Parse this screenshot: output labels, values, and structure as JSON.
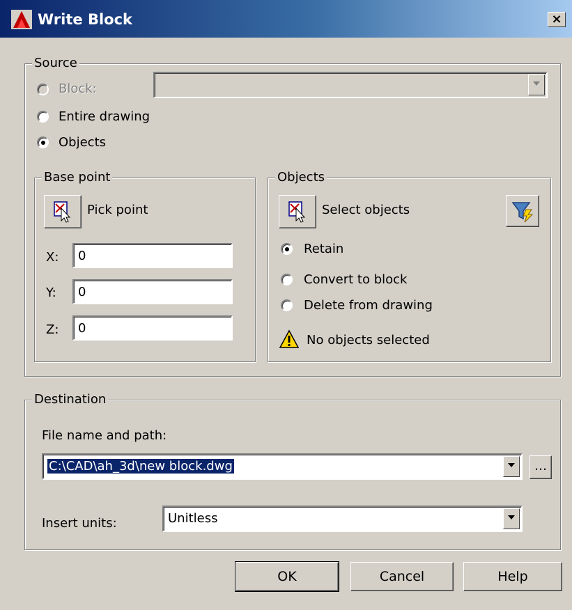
{
  "window": {
    "title": "Write Block",
    "close_label": "×"
  },
  "source": {
    "legend": "Source",
    "block_label": "Block:",
    "entire_drawing_label": "Entire drawing",
    "objects_label": "Objects",
    "selected_option": "Objects",
    "block_select_value": ""
  },
  "base_point": {
    "legend": "Base point",
    "pick_point_label": "Pick point",
    "x_label": "X:",
    "x_value": "0",
    "y_label": "Y:",
    "y_value": "0",
    "z_label": "Z:",
    "z_value": "0"
  },
  "objects": {
    "legend": "Objects",
    "select_objects_label": "Select objects",
    "retain_label": "Retain",
    "convert_label": "Convert to block",
    "delete_label": "Delete from drawing",
    "selected_option": "Retain",
    "warning_text": "No objects selected"
  },
  "destination": {
    "legend": "Destination",
    "file_label": "File name and path:",
    "file_value": "C:\\CAD\\ah_3d\\new block.dwg",
    "browse_label": "...",
    "units_label": "Insert units:",
    "units_value": "Unitless"
  },
  "buttons": {
    "ok": "OK",
    "cancel": "Cancel",
    "help": "Help"
  },
  "colors": {
    "title_bar_start": "#0a246a",
    "title_bar_end": "#a6caf0",
    "face": "#d4d0c8",
    "selection": "#0a246a",
    "warning": "#ffd700"
  },
  "icons": {
    "app": "autocad-logo-icon",
    "pick_point": "pick-point-icon",
    "select_objects": "select-objects-icon",
    "quick_select": "quick-select-filter-icon",
    "warning": "warning-triangle-icon"
  }
}
